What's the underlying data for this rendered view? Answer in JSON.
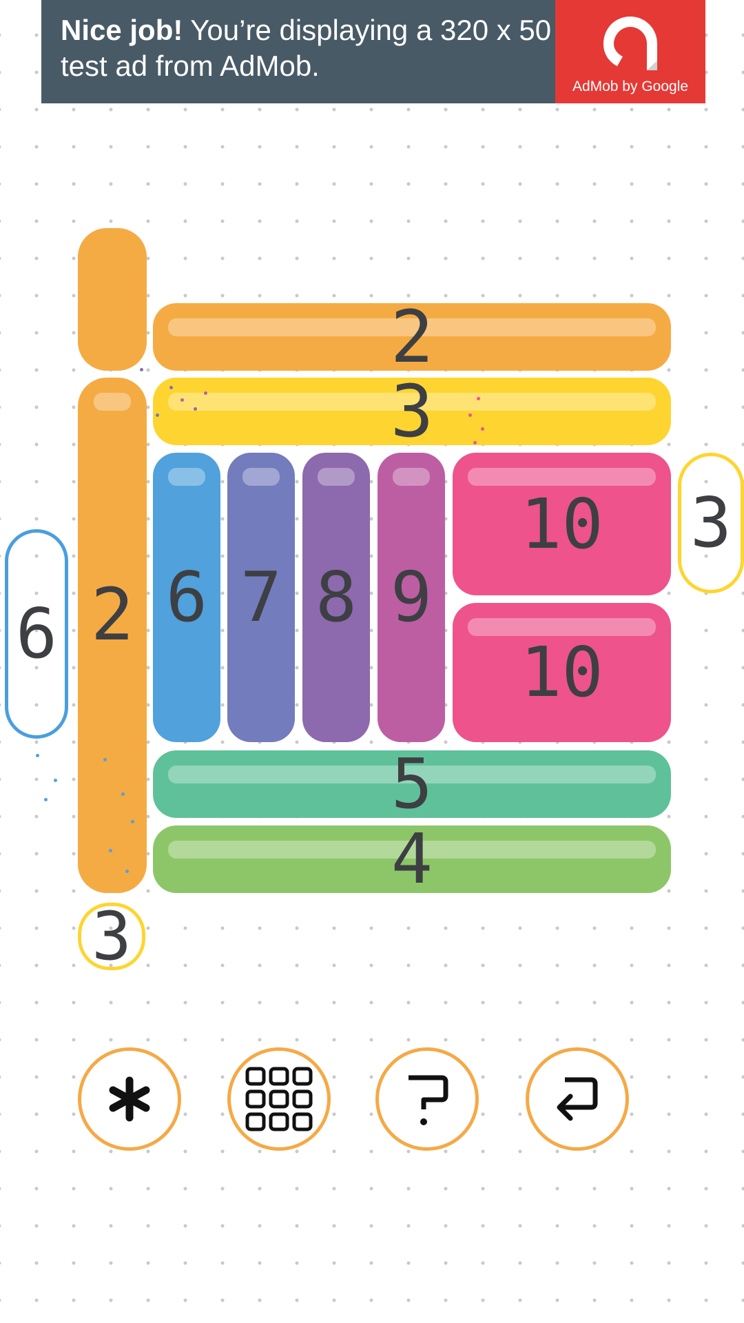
{
  "ad": {
    "bold": "Nice job!",
    "text": " You’re displaying a 320 x 50 test ad from AdMob.",
    "brand": "AdMob by Google"
  },
  "board": {
    "pieces": [
      {
        "id": "top-stub",
        "number": "",
        "color": "#f5ab43"
      },
      {
        "id": "bar-top",
        "number": "2",
        "color": "#f5ab43"
      },
      {
        "id": "bar-yellow",
        "number": "3",
        "color": "#fed530"
      },
      {
        "id": "left-column",
        "number": "2",
        "color": "#f5ab43"
      },
      {
        "id": "column-blue",
        "number": "6",
        "color": "#50a1dc"
      },
      {
        "id": "column-indigo",
        "number": "7",
        "color": "#737cbc"
      },
      {
        "id": "column-purple",
        "number": "8",
        "color": "#8d69ad"
      },
      {
        "id": "column-magenta",
        "number": "9",
        "color": "#bd5ea3"
      },
      {
        "id": "block-pink-top",
        "number": "10",
        "color": "#ee538b"
      },
      {
        "id": "block-pink-bottom",
        "number": "10",
        "color": "#ee538b"
      },
      {
        "id": "bar-teal",
        "number": "5",
        "color": "#5fc19a"
      },
      {
        "id": "bar-green",
        "number": "4",
        "color": "#8dc668"
      }
    ],
    "hints": [
      {
        "id": "hint-left",
        "number": "6",
        "color": "#4a9ede"
      },
      {
        "id": "hint-right",
        "number": "3",
        "color": "#fed530"
      },
      {
        "id": "hint-bottom",
        "number": "3",
        "color": "#fed530"
      }
    ]
  },
  "controls": [
    {
      "id": "star",
      "icon": "asterisk-icon"
    },
    {
      "id": "levels",
      "icon": "grid-icon"
    },
    {
      "id": "help",
      "icon": "question-icon"
    },
    {
      "id": "undo",
      "icon": "return-arrow-icon"
    }
  ],
  "colors": {
    "text": "#3d3f43",
    "control_border": "#f5a946",
    "ad_background": "#485a66",
    "ad_logo_background": "#e53935"
  }
}
